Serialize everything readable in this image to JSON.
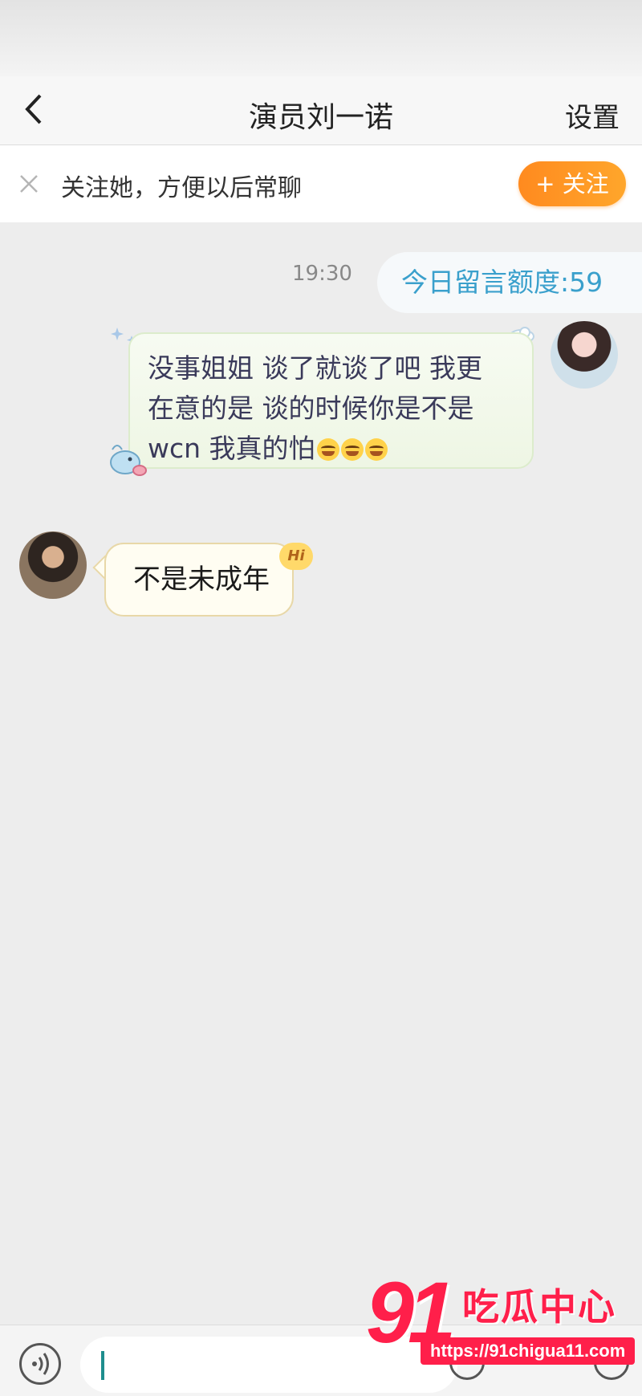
{
  "header": {
    "title": "演员刘一诺",
    "settings_label": "设置"
  },
  "follow_bar": {
    "text": "关注她，方便以后常聊",
    "button_label": "+ 关注"
  },
  "messages": {
    "timestamp": "19:30",
    "quota": "今日留言额度:59",
    "incoming_text_1": "没事姐姐 谈了就谈了吧 我更",
    "incoming_text_2": "在意的是 谈的时候你是不是",
    "incoming_text_3": "wcn 我真的怕",
    "reply_text": "不是未成年",
    "hi_badge": "Hi"
  },
  "watermark": {
    "number": "91",
    "name": "吃瓜中心",
    "url": "https://91chigua11.com"
  },
  "colors": {
    "accent_orange": "#ff8a1f",
    "quota_blue": "#3aa0cc",
    "watermark_red": "#ff1f4a"
  }
}
